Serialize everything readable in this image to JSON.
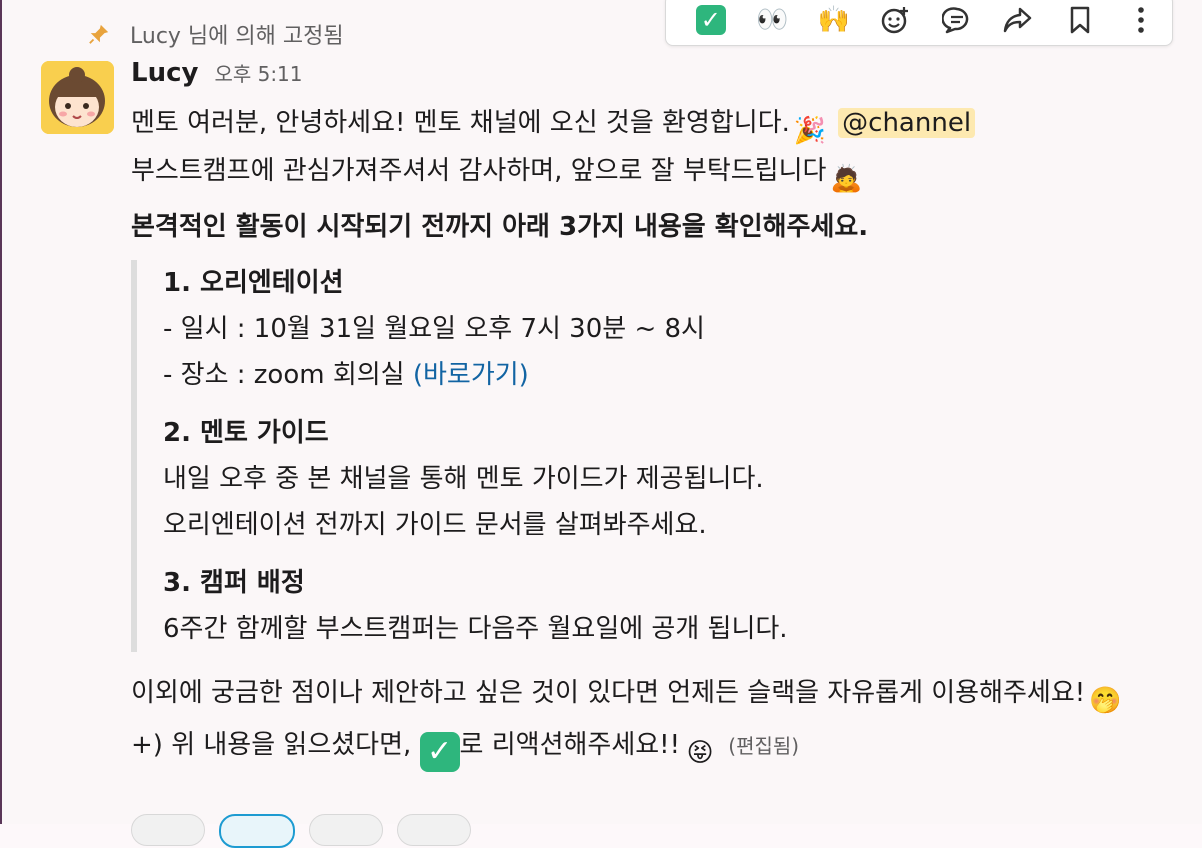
{
  "toolbar": {
    "items": [
      {
        "name": "check-reaction",
        "glyph": "✓"
      },
      {
        "name": "eyes-reaction",
        "glyph": "👀"
      },
      {
        "name": "raised-hands-reaction",
        "glyph": "🙌"
      }
    ]
  },
  "pinned": {
    "text": "Lucy 님에 의해 고정됨"
  },
  "message": {
    "author": "Lucy",
    "time": "오후 5:11",
    "line1": "멘토 여러분, 안녕하세요! 멘토 채널에 오신 것을 환영합니다.",
    "line1_emoji": "🎉",
    "mention": "@channel",
    "line2": "부스트캠프에 관심가져주셔서 감사하며, 앞으로 잘 부탁드립니다",
    "line2_emoji": "🙇",
    "bold": "본격적인 활동이 시작되기 전까지 아래 3가지 내용을 확인해주세요.",
    "sections": {
      "s1": {
        "title": "1. 오리엔테이션",
        "date": "- 일시 : 10월 31일 월요일 오후 7시 30분 ~ 8시",
        "place": "- 장소 : zoom 회의실 ",
        "place_link": "(바로가기)"
      },
      "s2": {
        "title": "2. 멘토 가이드",
        "line1": "내일 오후 중 본 채널을 통해 멘토 가이드가 제공됩니다.",
        "line2": "오리엔테이션 전까지 가이드 문서를 살펴봐주세요."
      },
      "s3": {
        "title": "3. 캠퍼 배정",
        "line1": "6주간 함께할 부스트캠퍼는 다음주 월요일에 공개 됩니다."
      }
    },
    "closing": "이외에 궁금한 점이나 제안하고 싶은 것이 있다면 언제든 슬랙을 자유롭게 이용해주세요!",
    "closing_emoji": "🤭",
    "ps_prefix": "+) 위 내용을 읽으셨다면, ",
    "ps_check": "✓",
    "ps_suffix": "로 리액션해주세요!!",
    "ps_emoji": "😝",
    "edited": "(편집됨)"
  }
}
